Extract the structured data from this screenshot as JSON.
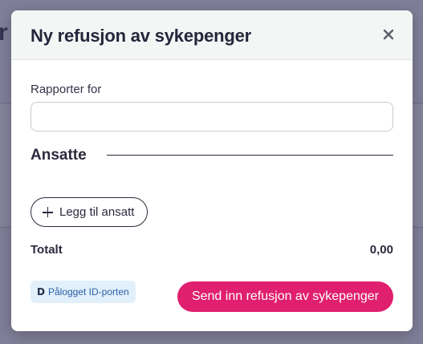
{
  "modal": {
    "title": "Ny refusjon av sykepenger",
    "close_icon": "close-icon",
    "report_for": {
      "label": "Rapporter for",
      "value": "",
      "placeholder": ""
    },
    "employees_heading": "Ansatte",
    "add_employee_label": "Legg til ansatt",
    "total": {
      "label": "Totalt",
      "value": "0,00"
    },
    "login_badge": "Pålogget ID-porten",
    "submit_label": "Send inn refusjon av sykepenger"
  },
  "colors": {
    "accent": "#e01f6e",
    "overlay": "#5b5a7e",
    "badge_bg": "#e2f0fb",
    "badge_text": "#2b5ea6"
  }
}
